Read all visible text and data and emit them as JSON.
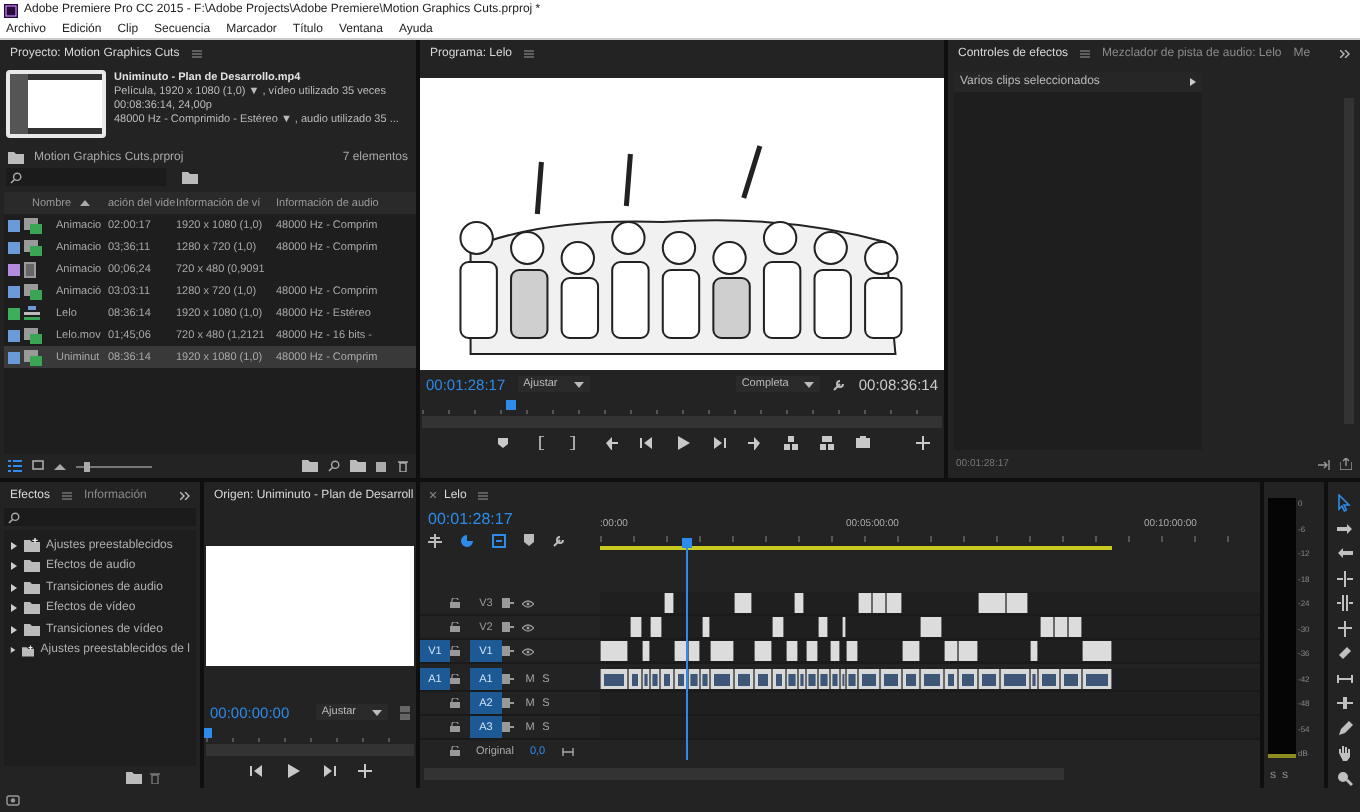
{
  "window": {
    "title": "Adobe Premiere Pro CC 2015 - F:\\Adobe Projects\\Adobe Premiere\\Motion Graphics Cuts.prproj *"
  },
  "menu": [
    "Archivo",
    "Edición",
    "Clip",
    "Secuencia",
    "Marcador",
    "Título",
    "Ventana",
    "Ayuda"
  ],
  "project": {
    "tab": "Proyecto: Motion Graphics Cuts",
    "clip_name": "Uniminuto - Plan de Desarrollo.mp4",
    "clip_info": [
      "Película, 1920 x 1080 (1,0) ▼ , vídeo utilizado 35 veces",
      "00:08:36:14, 24,00p",
      "48000 Hz - Comprimido - Estéreo ▼ , audio utilizado 35 ..."
    ],
    "zoom_slider": {
      "level": 0.12
    },
    "bin": "Motion Graphics Cuts.prproj",
    "count": "7 elementos",
    "columns": [
      "Nombre",
      "ación del vide",
      "Información de ví",
      "Información de audio"
    ],
    "rows": [
      {
        "color": "#6a9bd8",
        "kind": "movie",
        "name": "Animacio",
        "duration": "02:00:17",
        "video": "1920 x 1080 (1,0)",
        "audio": "48000 Hz - Comprim",
        "selected": false
      },
      {
        "color": "#6a9bd8",
        "kind": "movie",
        "name": "Animacio",
        "duration": "03;36;11",
        "video": "1280 x 720 (1,0)",
        "audio": "48000 Hz - Comprim",
        "selected": false
      },
      {
        "color": "#b58be0",
        "kind": "still",
        "name": "Animacio",
        "duration": "00;06;24",
        "video": "720 x 480 (0,9091",
        "selected": false
      },
      {
        "color": "#6a9bd8",
        "kind": "movie",
        "name": "Animació",
        "duration": "03:03:11",
        "video": "1280 x 720 (1,0)",
        "audio": "48000 Hz - Comprim",
        "selected": false
      },
      {
        "color": "#3fae5a",
        "kind": "sequence",
        "name": "Lelo",
        "duration": "08:36:14",
        "video": "1920 x 1080 (1,0)",
        "audio": "48000 Hz - Estéreo",
        "selected": false
      },
      {
        "color": "#6a9bd8",
        "kind": "movie",
        "name": "Lelo.mov",
        "duration": "01;45;06",
        "video": "720 x 480 (1,2121",
        "audio": "48000 Hz - 16 bits -",
        "selected": false
      },
      {
        "color": "#6a9bd8",
        "kind": "movie",
        "name": "Uniminut",
        "duration": "08:36:14",
        "video": "1920 x 1080 (1,0)",
        "audio": "48000 Hz - Comprim",
        "selected": true
      }
    ]
  },
  "program": {
    "tab": "Programa: Lelo",
    "timecode": "00:01:28:17",
    "zoom": "Ajustar",
    "quality": "Completa",
    "duration": "00:08:36:14",
    "playhead": {
      "level": 0.17
    }
  },
  "effect_controls": {
    "tabs": [
      {
        "label": "Controles de efectos",
        "selected": true
      },
      {
        "label": "Mezclador de pista de audio: Lelo",
        "selected": false
      },
      {
        "label": "Me",
        "selected": false
      }
    ],
    "message": "Varios clips seleccionados",
    "timecode": "00:01:28:17"
  },
  "effects": {
    "tabs": [
      {
        "label": "Efectos",
        "selected": true
      },
      {
        "label": "Información",
        "selected": false
      }
    ],
    "items": [
      {
        "label": "Ajustes preestablecidos",
        "kind": "preset",
        "expanded": false
      },
      {
        "label": "Efectos de audio",
        "kind": "folder",
        "expanded": false
      },
      {
        "label": "Transiciones de audio",
        "kind": "folder",
        "expanded": false
      },
      {
        "label": "Efectos de vídeo",
        "kind": "folder",
        "expanded": false
      },
      {
        "label": "Transiciones de vídeo",
        "kind": "folder",
        "expanded": false
      },
      {
        "label": "Ajustes preestablecidos de l",
        "kind": "preset",
        "expanded": false
      }
    ]
  },
  "source": {
    "tab": "Origen: Uniminuto - Plan de Desarroll",
    "timecode": "00:00:00:00",
    "zoom": "Ajustar",
    "playhead": {
      "level": 0
    }
  },
  "timeline": {
    "tab": "Lelo",
    "timecode": "00:01:28:17",
    "ruler": [
      ":00:00",
      "00:05:00:00",
      "00:10:00:00"
    ],
    "playhead": {
      "level": 0.13
    },
    "tracks": [
      {
        "kind": "video",
        "name": "V3",
        "targeted": false
      },
      {
        "kind": "video",
        "name": "V2",
        "targeted": false
      },
      {
        "kind": "video",
        "name": "V1",
        "source": "V1",
        "targeted": true
      },
      {
        "kind": "audio",
        "name": "A1",
        "source": "A1",
        "targeted": true,
        "buttons": [
          "M",
          "S"
        ]
      },
      {
        "kind": "audio",
        "name": "A2",
        "targeted": true,
        "buttons": [
          "M",
          "S"
        ]
      },
      {
        "kind": "audio",
        "name": "A3",
        "targeted": true,
        "buttons": [
          "M",
          "S"
        ]
      }
    ],
    "master": {
      "label": "Original",
      "value": "0,0"
    }
  },
  "meter": {
    "scale": [
      "0",
      "-6",
      "-12",
      "-18",
      "-24",
      "-30",
      "-36",
      "-42",
      "-48",
      "-54",
      "dB"
    ],
    "solo": [
      "S",
      "S"
    ]
  },
  "tools": [
    {
      "kind": "selection",
      "selected": true
    },
    {
      "kind": "track-forward",
      "selected": false
    },
    {
      "kind": "track-backward",
      "selected": false
    },
    {
      "kind": "ripple",
      "selected": false
    },
    {
      "kind": "rolling",
      "selected": false
    },
    {
      "kind": "rate",
      "selected": false
    },
    {
      "kind": "razor",
      "selected": false
    },
    {
      "kind": "slip",
      "selected": false
    },
    {
      "kind": "slide",
      "selected": false
    },
    {
      "kind": "pen",
      "selected": false
    },
    {
      "kind": "hand",
      "selected": false
    },
    {
      "kind": "zoom",
      "selected": false
    }
  ]
}
